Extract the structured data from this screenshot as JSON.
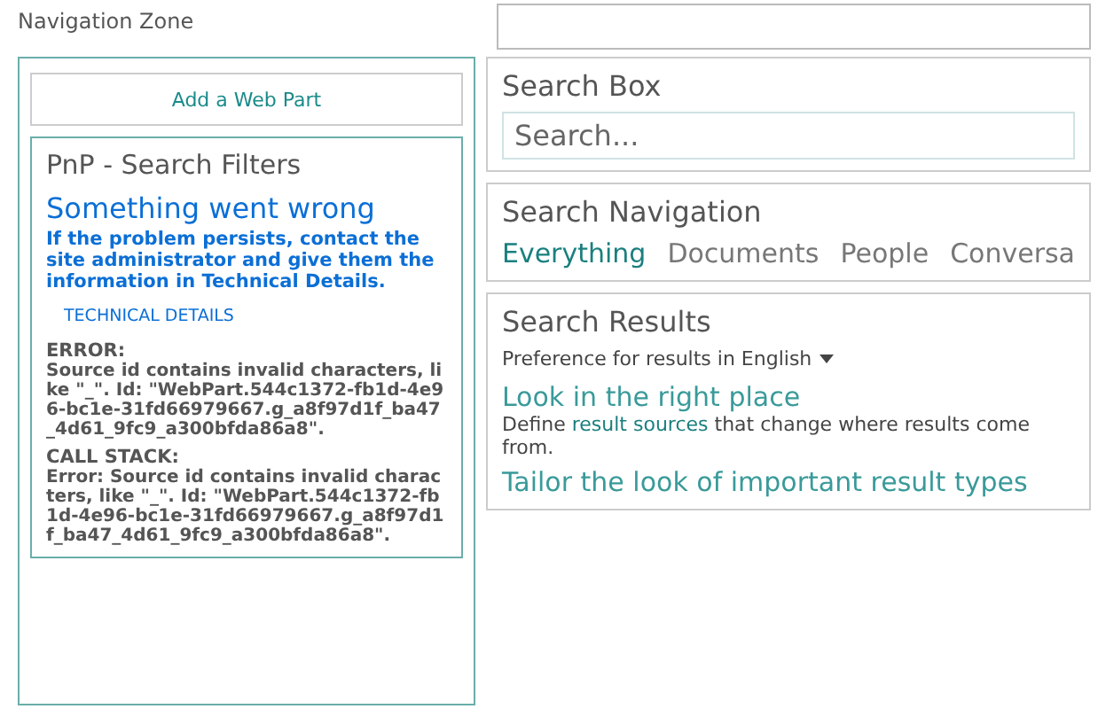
{
  "navigation_zone": {
    "label": "Navigation Zone",
    "add_web_part": "Add a Web Part"
  },
  "filters_panel": {
    "title": "PnP - Search Filters",
    "error_heading": "Something went wrong",
    "error_message": "If the problem persists, contact the site administrator and give them the information in Technical Details.",
    "technical_details_link": "TECHNICAL DETAILS",
    "sections": [
      {
        "label": "ERROR:",
        "text": "Source id contains invalid characters, like \"_\". Id: \"WebPart.544c1372-fb1d-4e96-bc1e-31fd66979667.g_a8f97d1f_ba47_4d61_9fc9_a300bfda86a8\"."
      },
      {
        "label": "CALL STACK:",
        "text": "Error: Source id contains invalid characters, like \"_\". Id: \"WebPart.544c1372-fb1d-4e96-bc1e-31fd66979667.g_a8f97d1f_ba47_4d61_9fc9_a300bfda86a8\"."
      }
    ]
  },
  "search_box": {
    "title": "Search Box",
    "placeholder": "Search..."
  },
  "search_navigation": {
    "title": "Search Navigation",
    "tabs": [
      {
        "label": "Everything",
        "selected": true
      },
      {
        "label": "Documents",
        "selected": false
      },
      {
        "label": "People",
        "selected": false
      },
      {
        "label": "Conversa",
        "selected": false
      }
    ]
  },
  "search_results": {
    "title": "Search Results",
    "language_preference": "Preference for results in English",
    "tips": [
      {
        "heading": "Look in the right place",
        "text_before": "Define ",
        "link": "result sources",
        "text_after": " that change where results come from."
      },
      {
        "heading": "Tailor the look of important result types"
      }
    ]
  }
}
